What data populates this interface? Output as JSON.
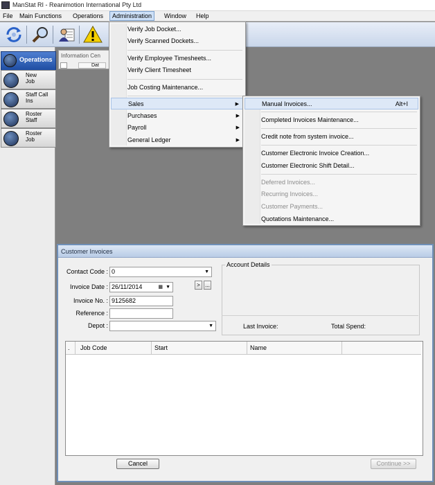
{
  "window": {
    "title": "ManStat RI - Reanimotion International Pty Ltd"
  },
  "menubar": {
    "items": [
      "File",
      "Main Functions",
      "Operations",
      "Administration",
      "Window",
      "Help"
    ],
    "active": "Administration"
  },
  "left_panel": {
    "header": "Operations",
    "items": [
      {
        "line1": "New",
        "line2": "Job"
      },
      {
        "line1": "Staff Call",
        "line2": "Ins"
      },
      {
        "line1": "Roster",
        "line2": "Staff"
      },
      {
        "line1": "Roster",
        "line2": "Job"
      }
    ]
  },
  "info_center": {
    "title": "Information Cen",
    "cell": "Dat"
  },
  "admin_menu": {
    "items": [
      "Verify Job Docket...",
      "Verify Scanned Dockets...",
      "Verify Employee Timesheets...",
      "Verify Client Timesheet",
      "Job Costing Maintenance...",
      "Sales",
      "Purchases",
      "Payroll",
      "General Ledger"
    ],
    "submenu_arrow": "▶"
  },
  "sales_menu": {
    "items": [
      {
        "label": "Manual Invoices...",
        "shortcut": "Alt+I"
      },
      {
        "label": "Completed Invoices Maintenance..."
      },
      {
        "label": "Credit note from system invoice..."
      },
      {
        "label": "Customer Electronic Invoice Creation..."
      },
      {
        "label": "Customer Electronic Shift Detail..."
      },
      {
        "label": "Deferred Invoices..."
      },
      {
        "label": "Recurring Invoices..."
      },
      {
        "label": "Customer Payments..."
      },
      {
        "label": "Quotations Maintenance..."
      }
    ]
  },
  "customer_invoices": {
    "title": "Customer Invoices",
    "contact_code_label": "Contact Code :",
    "contact_code_value": "0",
    "invoice_date_label": "Invoice Date :",
    "invoice_date_value": "26/11/2014",
    "invoice_no_label": "Invoice No. :",
    "invoice_no_value": "9125682",
    "reference_label": "Reference :",
    "reference_value": "",
    "depot_label": "Depot :",
    "depot_value": "",
    "next_btn": ">",
    "ellipsis_btn": "...",
    "account_details_label": "Account Details",
    "last_invoice_label": "Last Invoice:",
    "total_spend_label": "Total Spend:",
    "grid": {
      "row_marker": ".",
      "columns": [
        "Job Code",
        "Start",
        "Name"
      ]
    },
    "cancel_label": "Cancel",
    "continue_label": "Continue >>"
  }
}
